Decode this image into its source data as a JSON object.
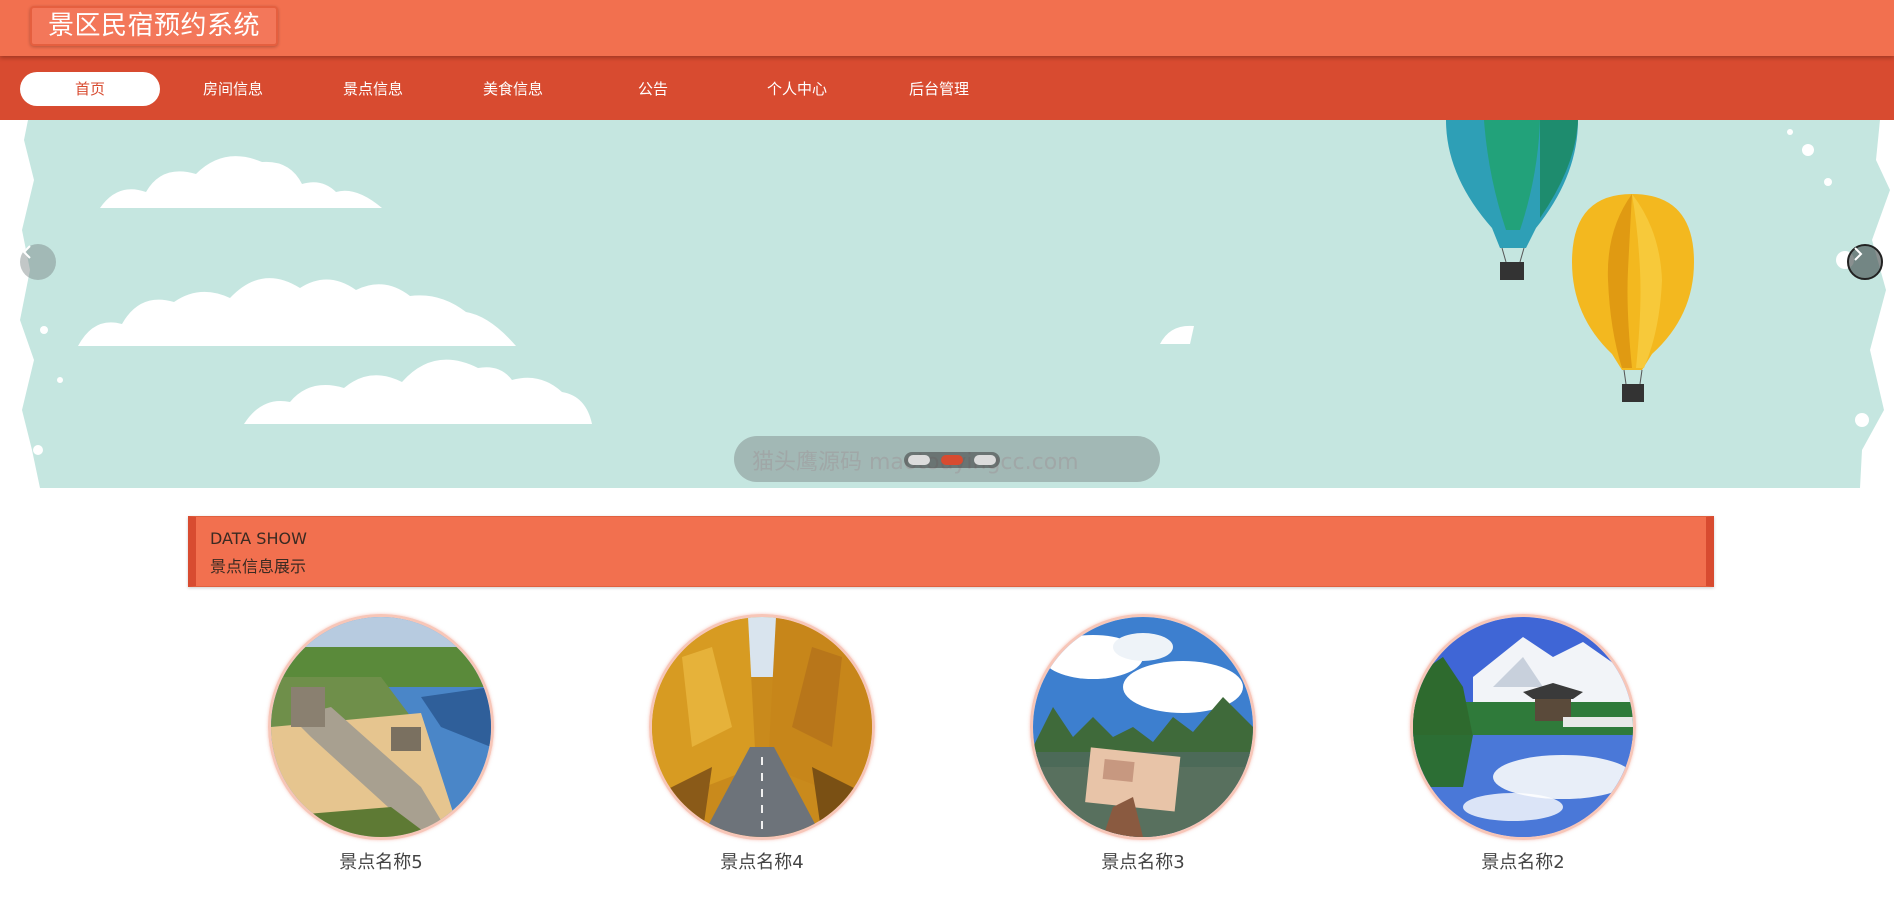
{
  "header": {
    "site_title": "景区民宿预约系统"
  },
  "nav": {
    "items": [
      {
        "label": "首页",
        "active": true
      },
      {
        "label": "房间信息",
        "active": false
      },
      {
        "label": "景点信息",
        "active": false
      },
      {
        "label": "美食信息",
        "active": false
      },
      {
        "label": "公告",
        "active": false
      },
      {
        "label": "个人中心",
        "active": false
      },
      {
        "label": "后台管理",
        "active": false
      }
    ]
  },
  "banner": {
    "watermark": "猫头鹰源码 maotouyingcc.com",
    "active_slide": 2,
    "slide_count": 3,
    "prev_icon": "chevron-left-icon",
    "next_icon": "chevron-right-icon"
  },
  "section": {
    "title_en": "DATA SHOW",
    "title_cn": "景点信息展示"
  },
  "attractions": [
    {
      "name": "景点名称5"
    },
    {
      "name": "景点名称4"
    },
    {
      "name": "景点名称3"
    },
    {
      "name": "景点名称2"
    }
  ],
  "colors": {
    "topbar": "#f2704f",
    "navbar": "#d84b30",
    "banner_bg": "#c5e6e0",
    "section_bg": "#f2704f"
  }
}
